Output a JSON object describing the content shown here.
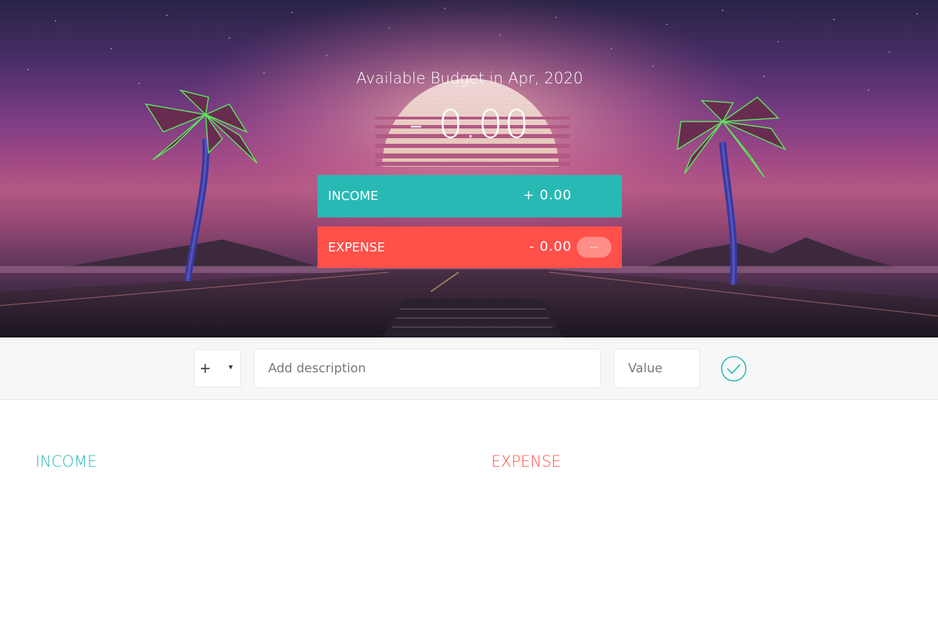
{
  "budget": {
    "title": "Available Budget in Apr, 2020",
    "value": "- 0.00"
  },
  "summary": {
    "income": {
      "label": "INCOME",
      "value": "+ 0.00"
    },
    "expense": {
      "label": "EXPENSE",
      "value": "- 0.00",
      "percentage": "---"
    }
  },
  "add_form": {
    "type_value": "+",
    "description_placeholder": "Add description",
    "value_placeholder": "Value",
    "submit_icon": "check-circle-icon"
  },
  "lists": {
    "income_title": "INCOME",
    "expense_title": "EXPENSE"
  },
  "colors": {
    "income": "#28b9b5",
    "expense": "#ff5049",
    "hero_background": "#7a3c86"
  }
}
